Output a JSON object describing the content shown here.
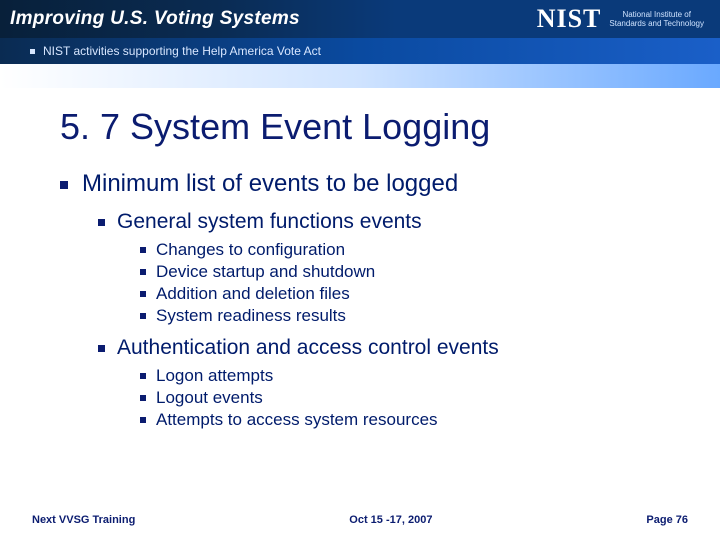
{
  "banner": {
    "title": "Improving U.S. Voting Systems",
    "subtitle": "NIST activities supporting the Help America Vote Act",
    "logo_abbr": "NIST",
    "logo_sub_line1": "National Institute of",
    "logo_sub_line2": "Standards and Technology"
  },
  "heading": "5. 7 System Event Logging",
  "lv1_item": "Minimum list of events to be logged",
  "groups": [
    {
      "label": "General system functions events",
      "items": [
        "Changes to configuration",
        "Device startup and shutdown",
        "Addition and deletion files",
        "System readiness results"
      ]
    },
    {
      "label": "Authentication and access control events",
      "items": [
        "Logon attempts",
        "Logout events",
        "Attempts to access system resources"
      ]
    }
  ],
  "footer": {
    "left": "Next VVSG Training",
    "center": "Oct 15 -17, 2007",
    "right": "Page 76"
  }
}
